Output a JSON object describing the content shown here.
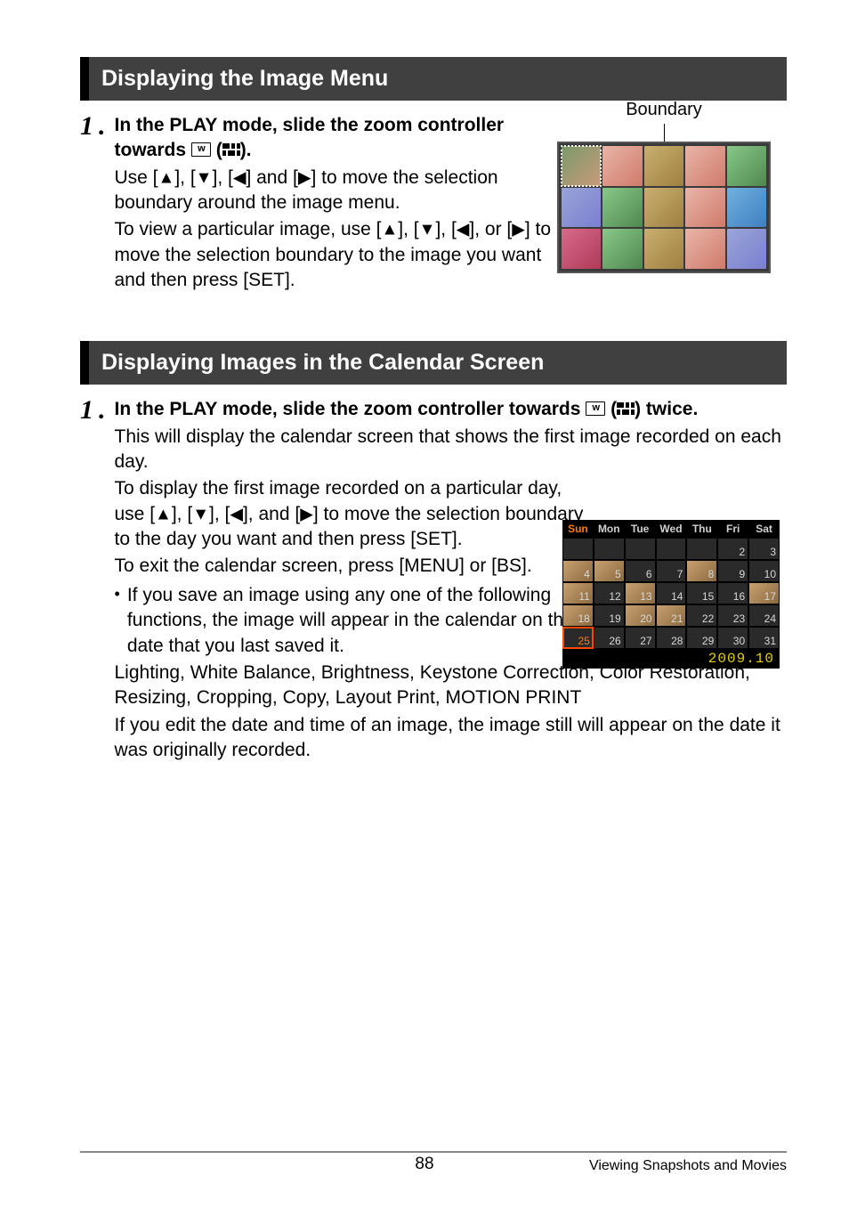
{
  "sections": {
    "s1": {
      "header": "Displaying the Image Menu",
      "step_num": "1",
      "step_dot": ".",
      "bold1": "In the PLAY mode, slide the zoom controller towards ",
      "bold3": " (",
      "bold5": ").",
      "desc1a": "Use [",
      "desc1b": "], [",
      "desc1c": "] and [",
      "desc1d": "] to move the selection boundary around the image menu.",
      "desc2a": "To view a particular image, use [",
      "desc2b": "], [",
      "desc2c": "], or [",
      "desc2d": "] to move the selection boundary to the image you want and then press [SET].",
      "boundary_label": "Boundary"
    },
    "s2": {
      "header": "Displaying Images in the Calendar Screen",
      "step_num": "1",
      "step_dot": ".",
      "bold1": "In the PLAY mode, slide the zoom controller towards ",
      "bold3": " (",
      "bold5": ") twice.",
      "desc_intro": "This will display the calendar screen that shows the first image recorded on each day.",
      "desc_p1a": "To display the first image recorded on a particular day, use [",
      "desc_p1b": "], [",
      "desc_p1c": "], and [",
      "desc_p1d": "] to move the selection boundary to the day you want and then press [SET].",
      "desc_p2": "To exit the calendar screen, press [MENU] or [BS].",
      "bullet1": "If you save an image using any one of the following functions, the image will appear in the calendar on the date that you last saved it.",
      "bullet1b": "Lighting, White Balance, Brightness, Keystone Correction, Color Restoration, Resizing, Cropping, Copy, Layout Print, MOTION PRINT",
      "bullet1c": "If you edit the date and time of an image, the image still will appear on the date it was originally recorded."
    }
  },
  "glyphs": {
    "w_label": "w",
    "up": "▲",
    "down": "▼",
    "left": "◀",
    "right": "▶",
    "bullet": "•"
  },
  "calendar": {
    "days": [
      "Sun",
      "Mon",
      "Tue",
      "Wed",
      "Thu",
      "Fri",
      "Sat"
    ],
    "footer": "2009.10",
    "cells": [
      {
        "n": "",
        "img": false
      },
      {
        "n": "",
        "img": false
      },
      {
        "n": "",
        "img": false
      },
      {
        "n": "",
        "img": false
      },
      {
        "n": "",
        "img": false
      },
      {
        "n": "2",
        "img": false
      },
      {
        "n": "3",
        "img": false
      },
      {
        "n": "4",
        "img": true
      },
      {
        "n": "5",
        "img": true
      },
      {
        "n": "6",
        "img": false
      },
      {
        "n": "7",
        "img": false
      },
      {
        "n": "8",
        "img": true
      },
      {
        "n": "9",
        "img": false
      },
      {
        "n": "10",
        "img": false
      },
      {
        "n": "11",
        "img": true
      },
      {
        "n": "12",
        "img": false
      },
      {
        "n": "13",
        "img": true
      },
      {
        "n": "14",
        "img": false
      },
      {
        "n": "15",
        "img": false
      },
      {
        "n": "16",
        "img": false
      },
      {
        "n": "17",
        "img": true
      },
      {
        "n": "18",
        "img": true
      },
      {
        "n": "19",
        "img": false
      },
      {
        "n": "20",
        "img": true
      },
      {
        "n": "21",
        "img": true
      },
      {
        "n": "22",
        "img": false
      },
      {
        "n": "23",
        "img": false
      },
      {
        "n": "24",
        "img": false
      },
      {
        "n": "25",
        "img": false,
        "sel": true
      },
      {
        "n": "26",
        "img": false
      },
      {
        "n": "27",
        "img": false
      },
      {
        "n": "28",
        "img": false
      },
      {
        "n": "29",
        "img": false
      },
      {
        "n": "30",
        "img": false
      },
      {
        "n": "31",
        "img": false
      }
    ]
  },
  "footer": {
    "page": "88",
    "section": "Viewing Snapshots and Movies"
  }
}
